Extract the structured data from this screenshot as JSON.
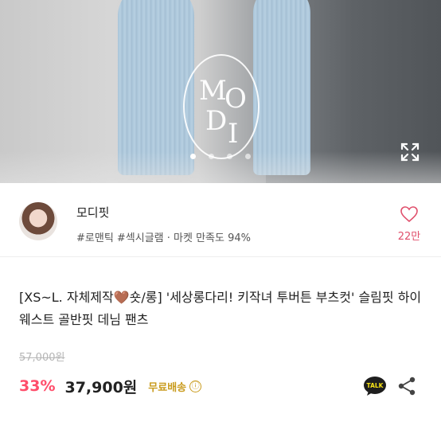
{
  "hero": {
    "brand_logo": "MODI",
    "slides_total": 4,
    "slide_active": 1,
    "expand_icon": "expand-icon"
  },
  "seller": {
    "name": "모디핏",
    "tags": "#로맨틱 #섹시글램 · 마켓 만족도 94%",
    "like_icon": "heart-outline-icon",
    "like_count": "22만"
  },
  "product": {
    "title": "[XS~L. 자체제작🤎숏/롱] '세상롱다리! 키작녀 투버튼 부츠컷' 슬림핏 하이웨스트 골반핏 데님 팬츠",
    "original_price": "57,000원",
    "discount": "33%",
    "price": "37,900원",
    "shipping": "무료배송",
    "info_icon": "ⓘ",
    "talk_label": "TALK"
  },
  "colors": {
    "accent_pink": "#ff4d6a",
    "like_pink": "#e0506c",
    "shipping_gold": "#c99b1d"
  }
}
